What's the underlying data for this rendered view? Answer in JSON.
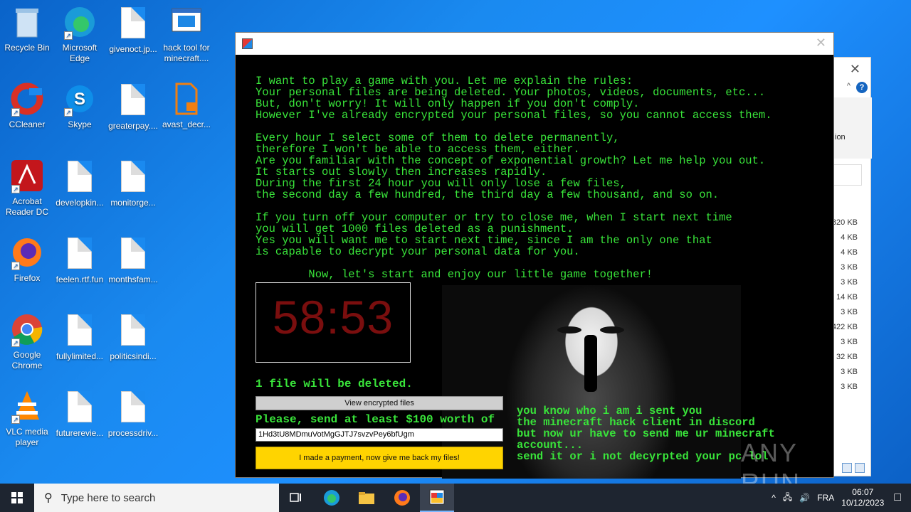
{
  "desktop": {
    "icons": [
      {
        "label": "Recycle Bin",
        "icon": "recycle-bin-icon"
      },
      {
        "label": "Microsoft Edge",
        "icon": "edge-icon"
      },
      {
        "label": "givenoct.jp...",
        "icon": "file-icon"
      },
      {
        "label": "hack tool for minecraft....",
        "icon": "window-app-icon"
      },
      {
        "label": "CCleaner",
        "icon": "ccleaner-icon"
      },
      {
        "label": "Skype",
        "icon": "skype-icon"
      },
      {
        "label": "greaterpay....",
        "icon": "file-icon"
      },
      {
        "label": "avast_decr...",
        "icon": "avast-decryptor-icon"
      },
      {
        "label": "Acrobat Reader DC",
        "icon": "acrobat-icon"
      },
      {
        "label": "developkin...",
        "icon": "file-icon"
      },
      {
        "label": "monitorge...",
        "icon": "file-icon"
      },
      {
        "label": "Firefox",
        "icon": "firefox-icon"
      },
      {
        "label": "feelen.rtf.fun",
        "icon": "file-icon"
      },
      {
        "label": "monthsfam...",
        "icon": "file-icon"
      },
      {
        "label": "Google Chrome",
        "icon": "chrome-icon"
      },
      {
        "label": "fullylimited...",
        "icon": "file-icon"
      },
      {
        "label": "politicsindi...",
        "icon": "file-icon"
      },
      {
        "label": "VLC media player",
        "icon": "vlc-icon"
      },
      {
        "label": "futurerevie...",
        "icon": "file-icon"
      },
      {
        "label": "processdriv...",
        "icon": "file-icon"
      }
    ]
  },
  "explorer": {
    "ribbon_fragment": "ion",
    "sizes": [
      "820 KB",
      "4 KB",
      "4 KB",
      "3 KB",
      "3 KB",
      "14 KB",
      "3 KB",
      "422 KB",
      "3 KB",
      "32 KB",
      "3 KB",
      "3 KB"
    ]
  },
  "ransom": {
    "message": "I want to play a game with you. Let me explain the rules:\nYour personal files are being deleted. Your photos, videos, documents, etc...\nBut, don't worry! It will only happen if you don't comply.\nHowever I've already encrypted your personal files, so you cannot access them.\n\nEvery hour I select some of them to delete permanently,\ntherefore I won't be able to access them, either.\nAre you familiar with the concept of exponential growth? Let me help you out.\nIt starts out slowly then increases rapidly.\nDuring the first 24 hour you will only lose a few files,\nthe second day a few hundred, the third day a few thousand, and so on.\n\nIf you turn off your computer or try to close me, when I start next time\nyou will get 1000 files deleted as a punishment.\nYes you will want me to start next time, since I am the only one that\nis capable to decrypt your personal data for you.\n\n        Now, let's start and enjoy our little game together!",
    "timer": "58:53",
    "files_deleted": "1 file will be deleted.",
    "view_button": "View encrypted files",
    "send_text": "Please, send at least $100 worth of",
    "btc_address": "1Hd3tU8MDmuVotMgGJTJ7svzvPey6bfUgm",
    "pay_button": "I made a payment, now give me back my files!",
    "note": "you know who i am i sent you\nthe minecraft hack client in discord\nbut now ur have to send me ur minecraft\naccount...\nsend it or i not decyrpted your pc lol",
    "watermark": "ANY RUN"
  },
  "taskbar": {
    "search_placeholder": "Type here to search",
    "language": "FRA",
    "time": "06:07",
    "date": "10/12/2023"
  }
}
